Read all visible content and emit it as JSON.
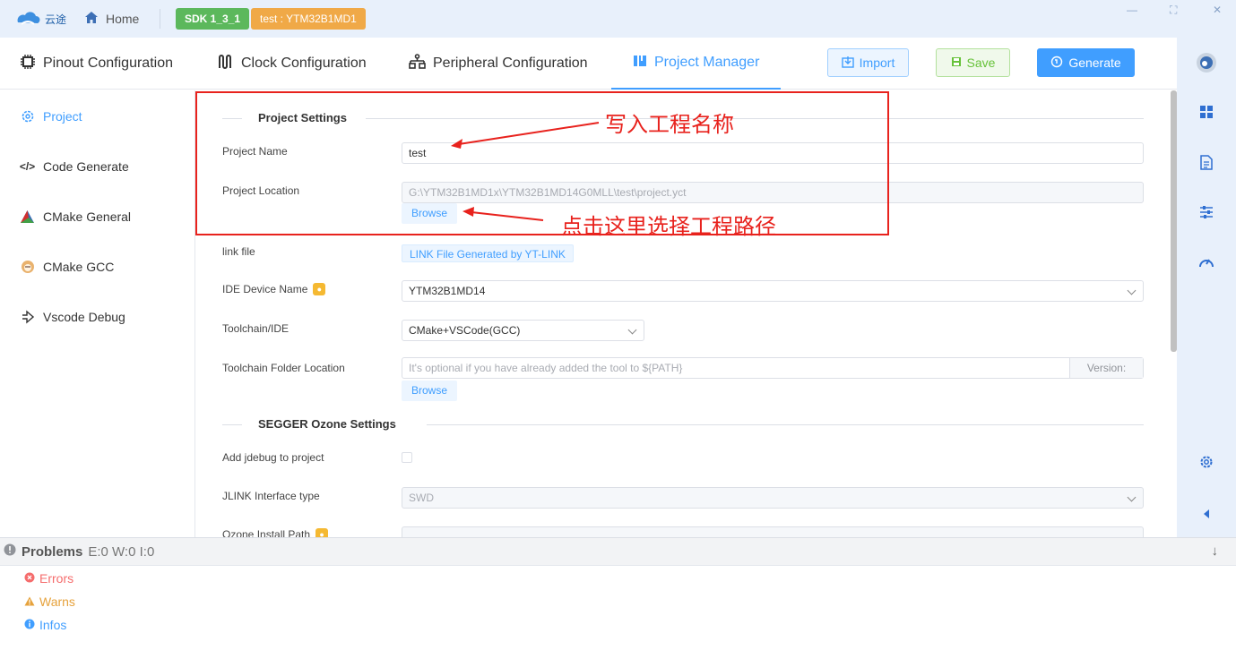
{
  "titlebar": {
    "logo_text": "云途",
    "home_label": "Home",
    "sdk_tag": "SDK 1_3_1",
    "project_tag": "test : YTM32B1MD1"
  },
  "tabs": [
    {
      "label": "Pinout Configuration",
      "icon": "chip-icon"
    },
    {
      "label": "Clock Configuration",
      "icon": "clock-wave-icon"
    },
    {
      "label": "Peripheral Configuration",
      "icon": "peripheral-icon"
    },
    {
      "label": "Project Manager",
      "icon": "project-icon",
      "active": true
    }
  ],
  "toolbar": {
    "import_label": "Import",
    "save_label": "Save",
    "generate_label": "Generate"
  },
  "sidebar": {
    "items": [
      {
        "label": "Project",
        "icon": "gear-icon",
        "active": true
      },
      {
        "label": "Code Generate",
        "icon": "code-icon"
      },
      {
        "label": "CMake General",
        "icon": "cmake-icon"
      },
      {
        "label": "CMake GCC",
        "icon": "gcc-icon"
      },
      {
        "label": "Vscode Debug",
        "icon": "debug-arrow-icon"
      }
    ]
  },
  "project_settings": {
    "section_title": "Project Settings",
    "project_name_label": "Project Name",
    "project_name_value": "test",
    "project_location_label": "Project Location",
    "project_location_value": "G:\\YTM32B1MD1x\\YTM32B1MD14G0MLL\\test\\project.yct",
    "browse_label": "Browse",
    "link_file_label": "link file",
    "link_file_value": "LINK File Generated by YT-LINK",
    "ide_device_label": "IDE Device Name",
    "ide_device_value": "YTM32B1MD14",
    "toolchain_label": "Toolchain/IDE",
    "toolchain_value": "CMake+VSCode(GCC)",
    "toolchain_folder_label": "Toolchain Folder Location",
    "toolchain_folder_placeholder": "It's optional if you have already added the tool to ${PATH}",
    "toolchain_version_label": "Version:",
    "browse2_label": "Browse"
  },
  "segger": {
    "section_title": "SEGGER Ozone Settings",
    "add_jdebug_label": "Add jdebug to project",
    "jlink_label": "JLINK Interface type",
    "jlink_value": "SWD",
    "ozone_label": "Ozone Install Path"
  },
  "annotations": {
    "name_note": "写入工程名称",
    "path_note": "点击这里选择工程路径"
  },
  "problems": {
    "title": "Problems",
    "counts": "E:0 W:0 I:0",
    "errors_label": "Errors",
    "warns_label": "Warns",
    "infos_label": "Infos"
  },
  "colors": {
    "accent": "#409eff",
    "success": "#67c23a",
    "warning": "#f0a947",
    "danger": "#f56c6c",
    "annotation": "#e8221d"
  }
}
